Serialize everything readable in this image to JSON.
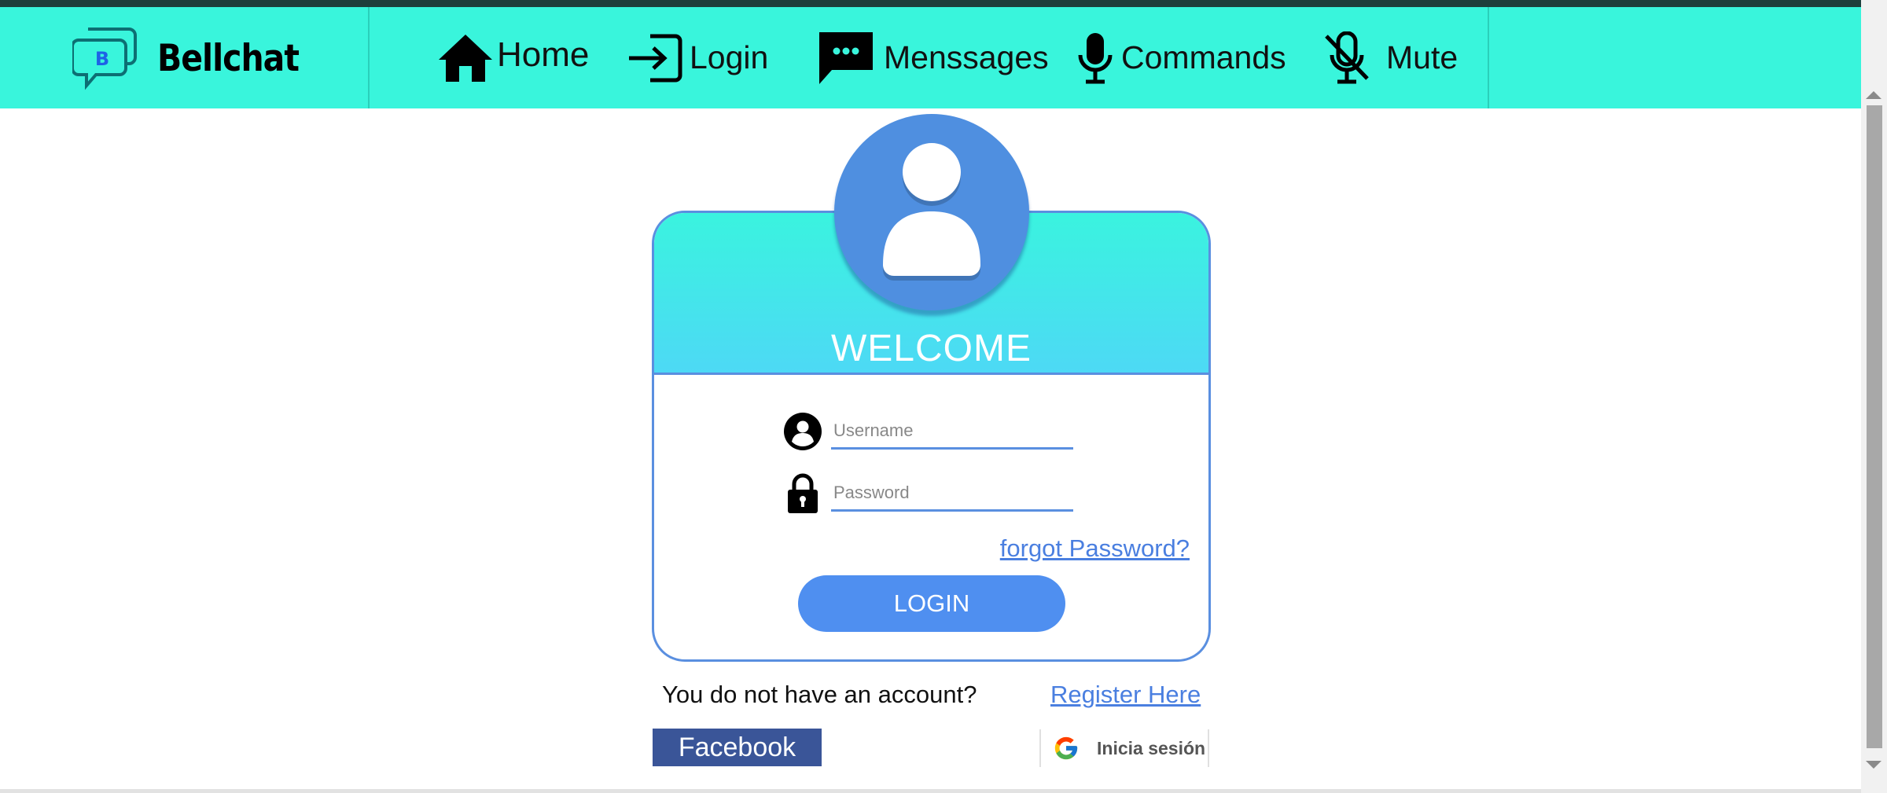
{
  "brand": {
    "logo_letter": "B",
    "name": "Bellchat"
  },
  "nav": {
    "items": [
      {
        "label": "Home",
        "icon": "home-icon"
      },
      {
        "label": "Login",
        "icon": "login-icon"
      },
      {
        "label": "Menssages",
        "icon": "message-icon"
      },
      {
        "label": "Commands",
        "icon": "microphone-icon"
      },
      {
        "label": "Mute",
        "icon": "microphone-off-icon"
      }
    ]
  },
  "login_card": {
    "title": "WELCOME",
    "username_placeholder": "Username",
    "password_placeholder": "Password",
    "forgot_label": "forgot Password?",
    "login_label": "LOGIN"
  },
  "signup": {
    "prompt": "You do not have an account?",
    "register_label": "Register Here"
  },
  "social": {
    "facebook_label": "Facebook",
    "google_label": "Inicia sesión"
  },
  "colors": {
    "navbar": "#39f5dc",
    "accent_blue": "#4f8ff0",
    "facebook_blue": "#3a5598"
  }
}
